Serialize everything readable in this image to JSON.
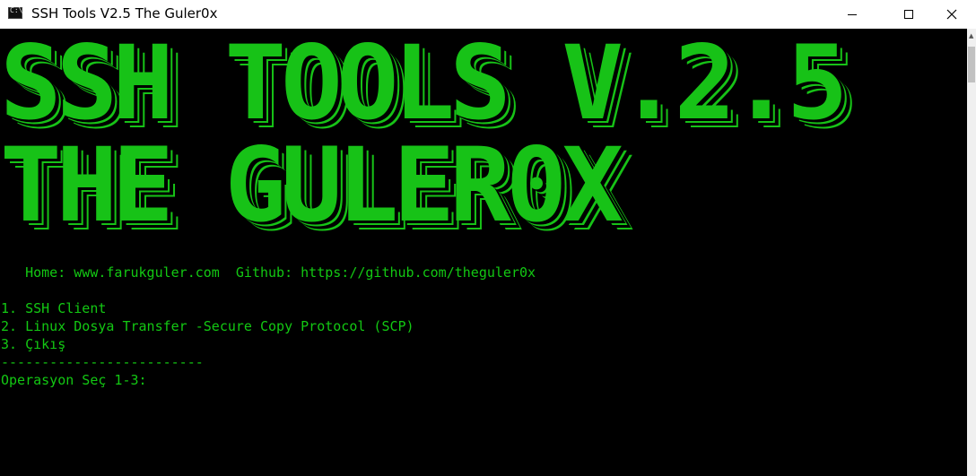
{
  "window": {
    "title": "SSH Tools V2.5 The Guler0x",
    "icon": "console-icon",
    "controls": {
      "minimize": "minimize-icon",
      "maximize": "maximize-icon",
      "close": "close-icon"
    }
  },
  "banner": {
    "line1": "SSH TOOLS V.2.5",
    "line2": "THE GULER0X"
  },
  "console": {
    "info": "   Home: www.farukguler.com  Github: https://github.com/theguler0x",
    "menu": [
      "1. SSH Client",
      "2. Linux Dosya Transfer -Secure Copy Protocol (SCP)",
      "3. Çıkış"
    ],
    "separator": "-------------------------",
    "prompt": "Operasyon Seç 1-3:"
  },
  "colors": {
    "text": "#13c813",
    "background": "#000000",
    "titlebar": "#ffffff"
  }
}
